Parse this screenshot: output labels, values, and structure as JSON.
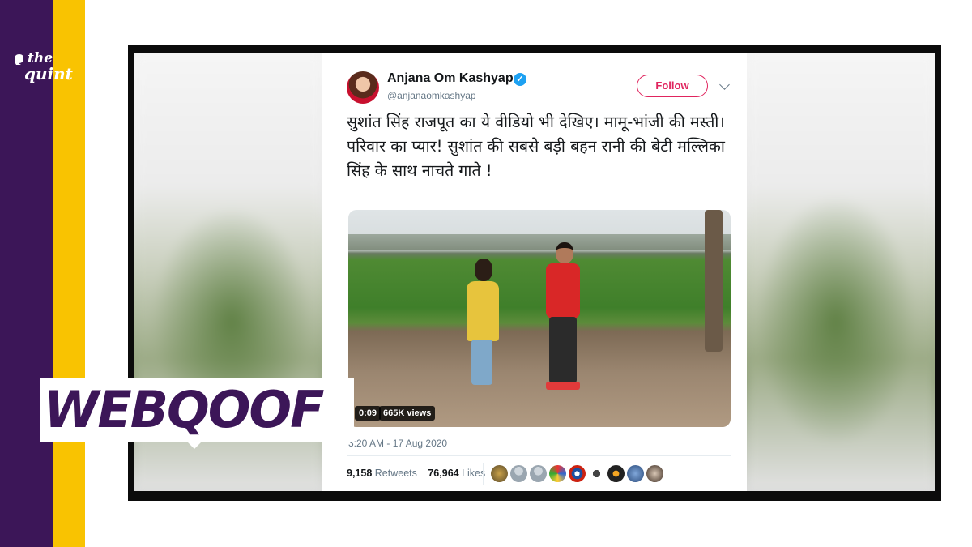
{
  "brand": {
    "logo_line1": "the",
    "logo_line2": "quint",
    "purple": "#3c1658",
    "yellow": "#f9c301"
  },
  "tweet": {
    "author_name": "Anjana Om Kashyap",
    "handle": "@anjanaomkashyap",
    "verified_icon": "verified-badge-icon",
    "follow_label": "Follow",
    "text": "सुशांत सिंह राजपूत का ये वीडियो भी देखिए। मामू-भांजी की मस्ती। परिवार का प्यार! सुशांत की सबसे बड़ी बहन रानी की बेटी मल्लिका सिंह के साथ नाचते गाते !",
    "video": {
      "duration": "0:09",
      "views": "665K views"
    },
    "timestamp": "3:20 AM - 17 Aug 2020",
    "retweets_count": "9,158",
    "retweets_label": "Retweets",
    "likes_count": "76,964",
    "likes_label": "Likes",
    "accent": "#e0245e"
  },
  "overlay": {
    "label": "WEBQOOF"
  }
}
